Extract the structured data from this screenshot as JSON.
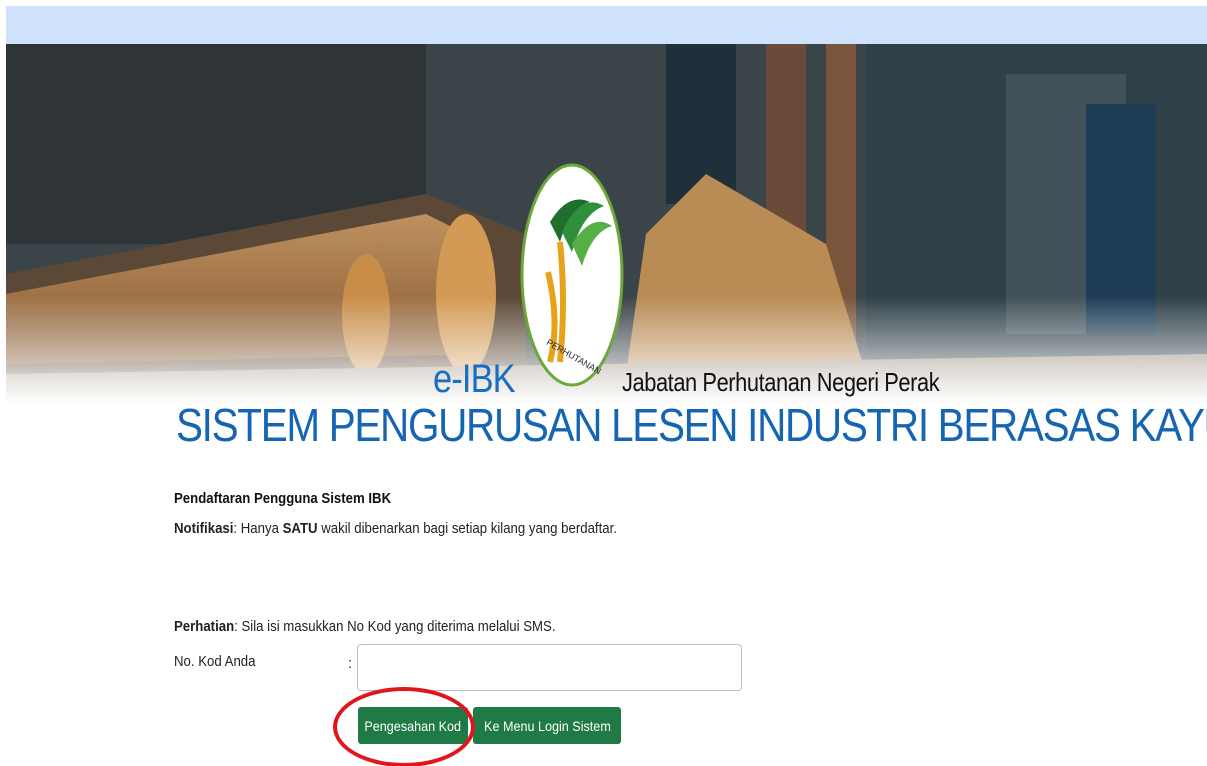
{
  "brand": {
    "short_name": "e-IBK",
    "department": "Jabatan Perhutanan Negeri Perak",
    "logo_text": "PERHUTANAN"
  },
  "system_title": "SISTEM PENGURUSAN LESEN INDUSTRI BERASAS KAYU",
  "form": {
    "heading": "Pendaftaran Pengguna Sistem IBK",
    "notification": {
      "label": "Notifikasi",
      "text_before": ": Hanya ",
      "emphasis": "SATU",
      "text_after": " wakil dibenarkan bagi setiap kilang yang berdaftar."
    },
    "notice": {
      "label": "Perhatian",
      "text": ": Sila isi masukkan No Kod yang diterima melalui SMS."
    },
    "code_field": {
      "label": "No. Kod Anda",
      "separator": ":",
      "value": "",
      "placeholder": ""
    },
    "buttons": {
      "confirm": "Pengesahan Kod",
      "login_menu": "Ke Menu Login Sistem"
    }
  },
  "colors": {
    "top_strip": "#cfe2fb",
    "title_blue": "#1565b3",
    "button_green": "#1f7a45",
    "highlight_red": "#e0161d"
  }
}
